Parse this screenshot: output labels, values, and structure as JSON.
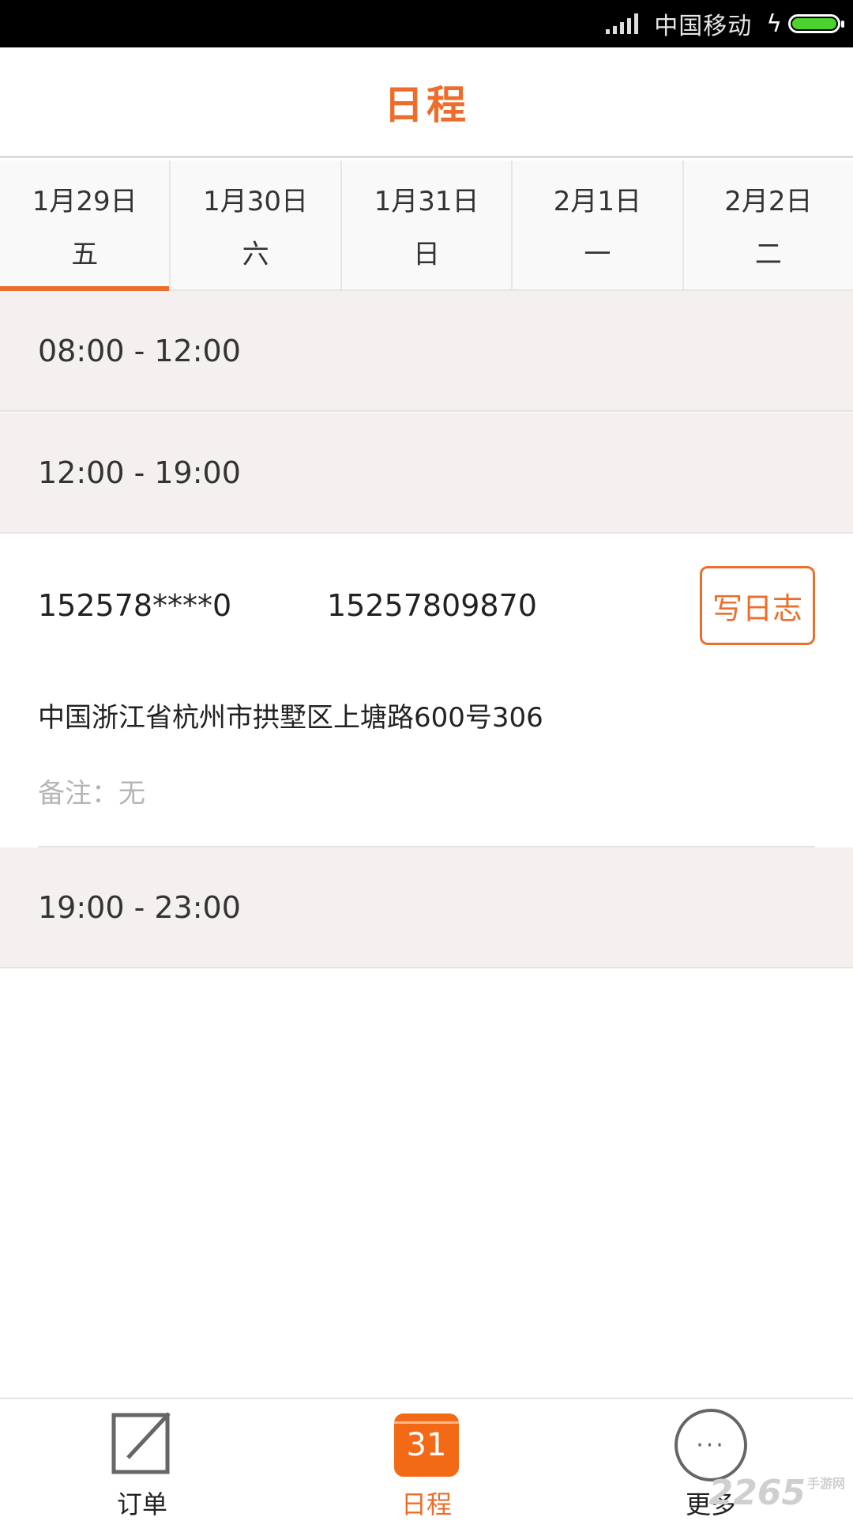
{
  "status_bar": {
    "carrier": "中国移动",
    "battery_color": "#4cd22c"
  },
  "header": {
    "title": "日程"
  },
  "accent_color": "#ec6e2c",
  "date_tabs": [
    {
      "date": "1月29日",
      "weekday": "五",
      "active": true
    },
    {
      "date": "1月30日",
      "weekday": "六"
    },
    {
      "date": "1月31日",
      "weekday": "日"
    },
    {
      "date": "2月1日",
      "weekday": "一"
    },
    {
      "date": "2月2日",
      "weekday": "二"
    }
  ],
  "slots": [
    {
      "time": "08:00 - 12:00"
    },
    {
      "time": "12:00 - 19:00"
    },
    {
      "time": "19:00 - 23:00"
    }
  ],
  "entry": {
    "name": "152578****0",
    "phone": "15257809870",
    "log_button": "写日志",
    "address": "中国浙江省杭州市拱墅区上塘路600号306",
    "note": "备注：无"
  },
  "tabbar": {
    "orders": {
      "label": "订单",
      "icon": "edit-icon"
    },
    "schedule": {
      "label": "日程",
      "icon": "calendar-icon",
      "icon_text": "31"
    },
    "more": {
      "label": "更多",
      "icon": "more-icon"
    }
  },
  "watermark": {
    "text": "2265",
    "suffix": "手游网"
  }
}
